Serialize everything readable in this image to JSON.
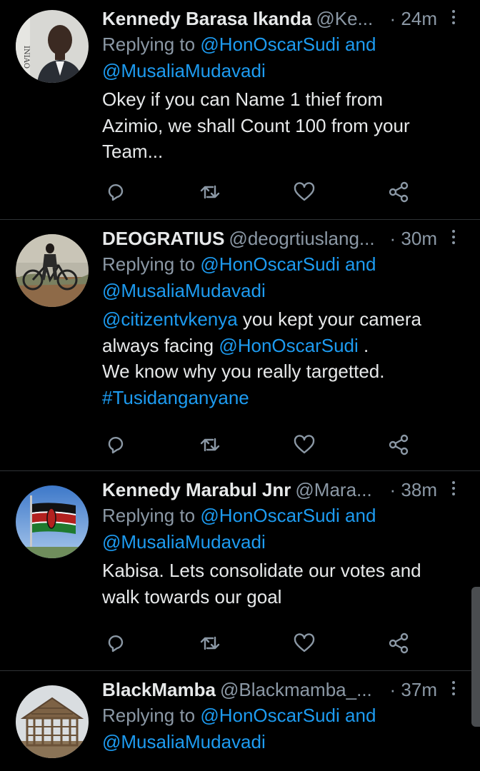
{
  "tweets": [
    {
      "name": "Kennedy Barasa Ikanda",
      "handle": "@Ke...",
      "time": "· 24m",
      "replying_prefix": "Replying to ",
      "mention_1": "@HonOscarSudi",
      "and_word": " and",
      "mention_2": "@MusaliaMudavadi",
      "text_lines": [
        "Okey if you can Name 1 thief from",
        "Azimio, we shall Count 100 from your",
        "Team..."
      ]
    },
    {
      "name": "DEOGRATIUS",
      "handle": "@deogrtiuslang...",
      "time": "· 30m",
      "replying_prefix": "Replying to ",
      "mention_1": "@HonOscarSudi",
      "and_word": " and",
      "mention_2": "@MusaliaMudavadi",
      "body_mention_1": "@citizentvkenya",
      "body_text_1": " you kept your camera",
      "body_text_2": "always facing ",
      "body_mention_2": "@HonOscarSudi",
      "body_text_3": " .",
      "body_text_4": "We know why you really targetted.",
      "hashtag": "#Tusidanganyane"
    },
    {
      "name": "Kennedy Marabul Jnr",
      "handle": "@Mara...",
      "time": "· 38m",
      "replying_prefix": "Replying to ",
      "mention_1": "@HonOscarSudi",
      "and_word": " and",
      "mention_2": "@MusaliaMudavadi",
      "text_lines": [
        "Kabisa. Lets consolidate our votes and",
        "walk towards our goal"
      ]
    },
    {
      "name": "BlackMamba",
      "handle": "@Blackmamba_...",
      "time": "· 37m",
      "replying_prefix": "Replying to ",
      "mention_1": "@HonOscarSudi",
      "and_word": " and",
      "mention_2": "@MusaliaMudavadi"
    }
  ],
  "icons": {
    "reply": "reply-icon",
    "retweet": "retweet-icon",
    "like": "heart-icon",
    "share": "share-icon",
    "more": "more-vertical-icon"
  },
  "colors": {
    "background": "#000000",
    "text": "#e7e9ea",
    "secondary": "#8b98a5",
    "link": "#1d9bf0",
    "divider": "#2f3336"
  }
}
